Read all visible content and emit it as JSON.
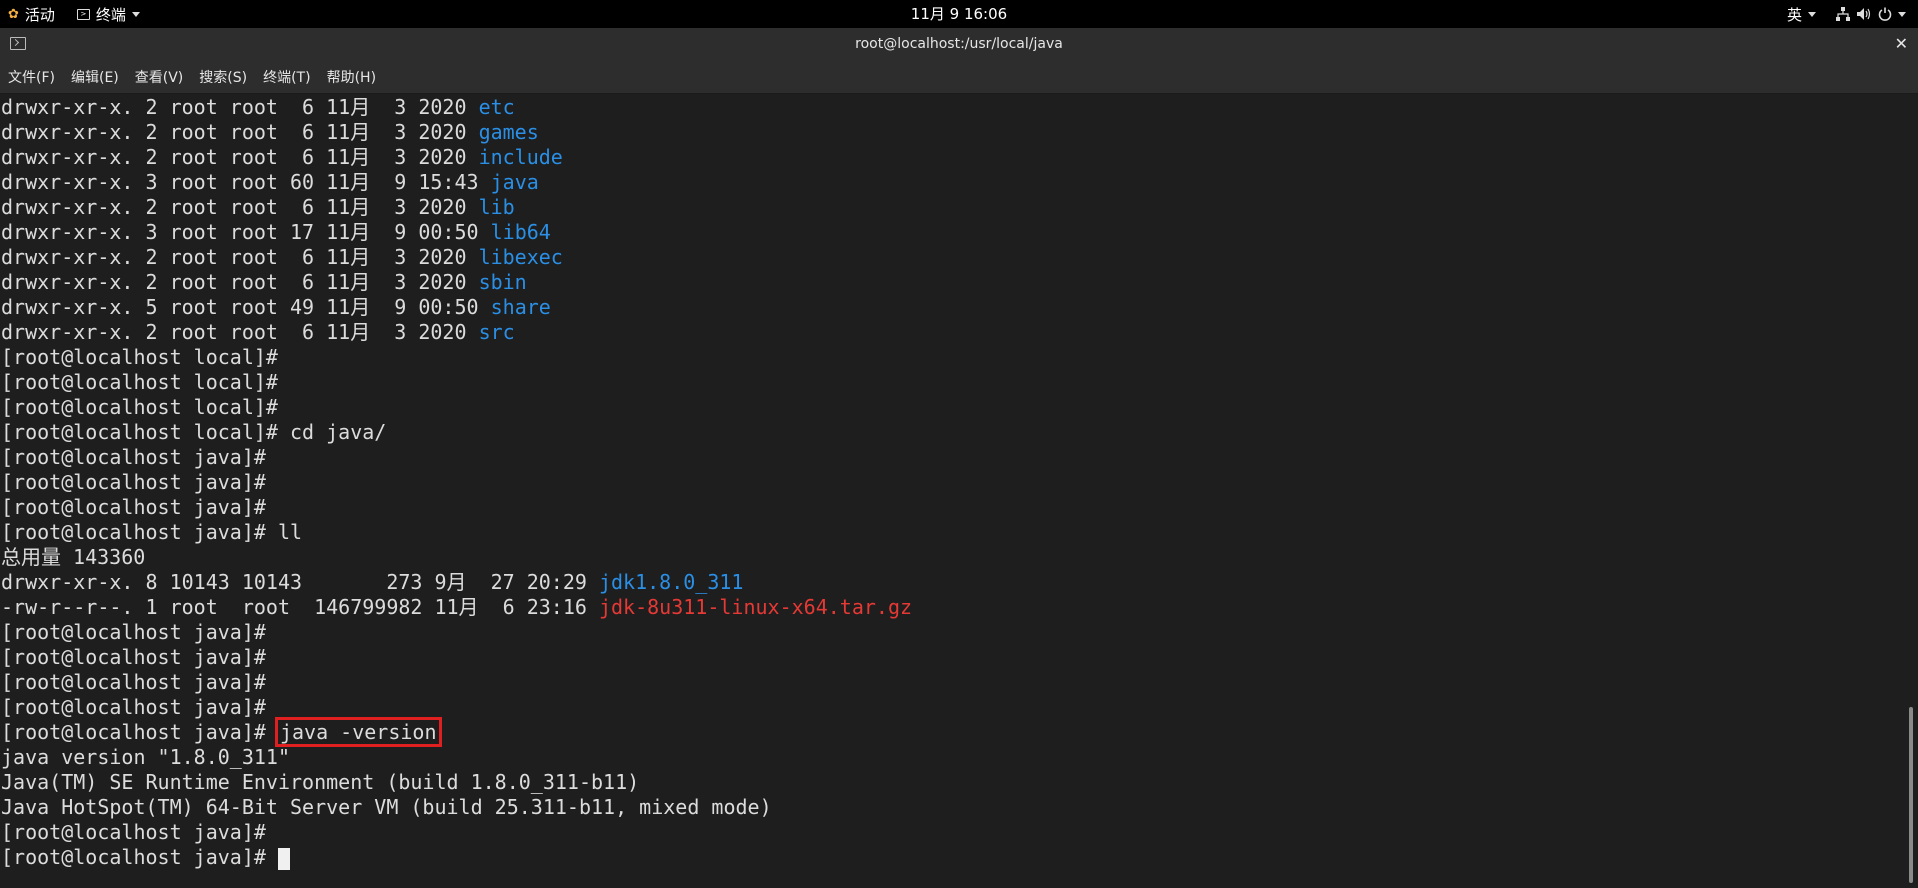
{
  "topbar": {
    "activities": "活动",
    "app_menu": "终端",
    "clock": "11月 9 16:06",
    "input_method": "英"
  },
  "window": {
    "title": "root@localhost:/usr/local/java",
    "close_glyph": "✕"
  },
  "menu": [
    "文件(F)",
    "编辑(E)",
    "查看(V)",
    "搜索(S)",
    "终端(T)",
    "帮助(H)"
  ],
  "terminal": {
    "listing1": [
      {
        "meta": "drwxr-xr-x. 2 root root  6 11月  3 2020 ",
        "name": "etc"
      },
      {
        "meta": "drwxr-xr-x. 2 root root  6 11月  3 2020 ",
        "name": "games"
      },
      {
        "meta": "drwxr-xr-x. 2 root root  6 11月  3 2020 ",
        "name": "include"
      },
      {
        "meta": "drwxr-xr-x. 3 root root 60 11月  9 15:43 ",
        "name": "java"
      },
      {
        "meta": "drwxr-xr-x. 2 root root  6 11月  3 2020 ",
        "name": "lib"
      },
      {
        "meta": "drwxr-xr-x. 3 root root 17 11月  9 00:50 ",
        "name": "lib64"
      },
      {
        "meta": "drwxr-xr-x. 2 root root  6 11月  3 2020 ",
        "name": "libexec"
      },
      {
        "meta": "drwxr-xr-x. 2 root root  6 11月  3 2020 ",
        "name": "sbin"
      },
      {
        "meta": "drwxr-xr-x. 5 root root 49 11月  9 00:50 ",
        "name": "share"
      },
      {
        "meta": "drwxr-xr-x. 2 root root  6 11月  3 2020 ",
        "name": "src"
      }
    ],
    "block2": [
      "[root@localhost local]#",
      "[root@localhost local]#",
      "[root@localhost local]#",
      "[root@localhost local]# cd java/",
      "[root@localhost java]#",
      "[root@localhost java]#",
      "[root@localhost java]#",
      "[root@localhost java]# ll",
      "总用量 143360"
    ],
    "listing2": [
      {
        "meta": "drwxr-xr-x. 8 10143 10143       273 9月  27 20:29 ",
        "name": "jdk1.8.0_311",
        "color": "#2a8fe5"
      },
      {
        "meta": "-rw-r--r--. 1 root  root  146799982 11月  6 23:16 ",
        "name": "jdk-8u311-linux-x64.tar.gz",
        "color": "#e53935"
      }
    ],
    "block3": [
      "[root@localhost java]#",
      "[root@localhost java]#",
      "[root@localhost java]#",
      "[root@localhost java]#"
    ],
    "cmd_prompt": "[root@localhost java]# ",
    "cmd_text": "java -version",
    "output": [
      "java version \"1.8.0_311\"",
      "Java(TM) SE Runtime Environment (build 1.8.0_311-b11)",
      "Java HotSpot(TM) 64-Bit Server VM (build 25.311-b11, mixed mode)",
      "[root@localhost java]#"
    ],
    "last_prompt": "[root@localhost java]# "
  }
}
